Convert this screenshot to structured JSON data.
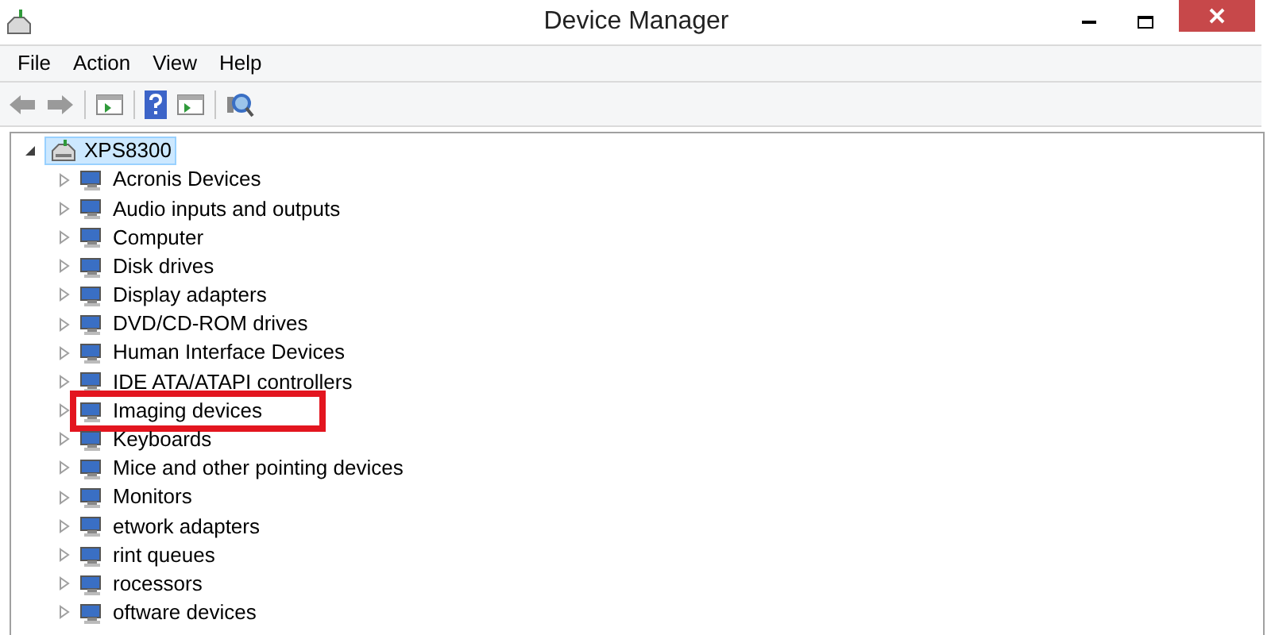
{
  "window": {
    "title": "Device Manager"
  },
  "menu": [
    "File",
    "Action",
    "View",
    "Help"
  ],
  "tree": {
    "label": "XPS8300",
    "selected": true,
    "expanded": true,
    "children": [
      {
        "label": "Acronis Devices",
        "expanded": false,
        "highlighted": false
      },
      {
        "label": "Audio inputs and outputs",
        "expanded": false,
        "highlighted": false
      },
      {
        "label": "Computer",
        "expanded": false,
        "highlighted": false
      },
      {
        "label": "Disk drives",
        "expanded": false,
        "highlighted": false
      },
      {
        "label": "Display adapters",
        "expanded": false,
        "highlighted": false
      },
      {
        "label": "DVD/CD-ROM drives",
        "expanded": false,
        "highlighted": false
      },
      {
        "label": "Human Interface Devices",
        "expanded": false,
        "highlighted": false
      },
      {
        "label": "IDE ATA/ATAPI controllers",
        "expanded": false,
        "highlighted": false
      },
      {
        "label": "Imaging devices",
        "expanded": false,
        "highlighted": true
      },
      {
        "label": "Keyboards",
        "expanded": false,
        "highlighted": false
      },
      {
        "label": "Mice and other pointing devices",
        "expanded": false,
        "highlighted": false
      },
      {
        "label": "Monitors",
        "expanded": false,
        "highlighted": false
      },
      {
        "label": "etwork adapters",
        "expanded": false,
        "highlighted": false
      },
      {
        "label": "rint queues",
        "expanded": false,
        "highlighted": false
      },
      {
        "label": "rocessors",
        "expanded": false,
        "highlighted": false
      },
      {
        "label": "oftware devices",
        "expanded": false,
        "highlighted": false
      }
    ]
  }
}
